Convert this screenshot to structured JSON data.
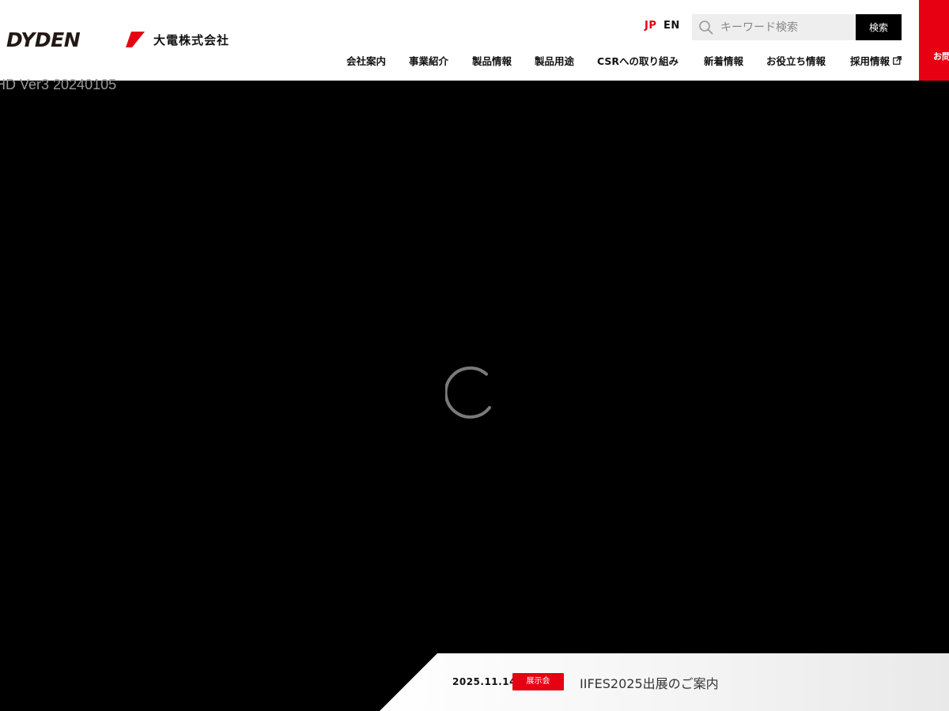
{
  "header": {
    "logo_text": "DYDEN",
    "company_name": "大電株式会社",
    "lang": {
      "jp": "JP",
      "en": "EN"
    },
    "search": {
      "placeholder": "キーワード検索",
      "button_label": "検索"
    },
    "nav": [
      {
        "label": "会社案内"
      },
      {
        "label": "事業紹介"
      },
      {
        "label": "製品情報"
      },
      {
        "label": "製品用途"
      },
      {
        "label": "CSRへの取り組み"
      },
      {
        "label": "新着情報"
      },
      {
        "label": "お役立ち情報"
      },
      {
        "label": "採用情報",
        "external_icon": "external-link-icon"
      }
    ],
    "contact_tab_label": "お問",
    "colors": {
      "accent": "#e60012",
      "header_bg": "#ffffff",
      "search_bg": "#eeeeee"
    }
  },
  "hero": {
    "video_label": "HD Ver3 20240105",
    "loading_icon": "loading-spinner-icon",
    "background": "#000000"
  },
  "news": {
    "date": "2025.11.14",
    "category": "展示会",
    "title": "IIFES2025出展のご案内"
  }
}
